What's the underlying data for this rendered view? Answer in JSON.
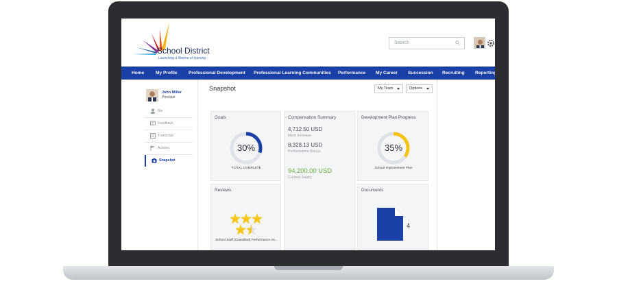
{
  "brand": {
    "name": "School District",
    "tagline": "Launching a lifetime of learning"
  },
  "search": {
    "placeholder": "Search"
  },
  "nav": {
    "items": [
      {
        "label": "Home"
      },
      {
        "label": "My Profile"
      },
      {
        "label": "Professional Development"
      },
      {
        "label": "Professional Learning Communities"
      },
      {
        "label": "Performance"
      },
      {
        "label": "My Career"
      },
      {
        "label": "Succession"
      },
      {
        "label": "Recruiting"
      },
      {
        "label": "Reporting"
      }
    ]
  },
  "profile": {
    "name": "John Miller",
    "role": "Principal"
  },
  "sidebar": {
    "items": [
      {
        "label": "Bio",
        "icon": "user-icon"
      },
      {
        "label": "Feedback",
        "icon": "feedback-icon"
      },
      {
        "label": "Transcript",
        "icon": "transcript-icon"
      },
      {
        "label": "Actions",
        "icon": "flag-icon"
      },
      {
        "label": "Snapshot",
        "icon": "camera-icon",
        "active": true
      }
    ]
  },
  "main": {
    "title": "Snapshot",
    "my_team": "My Team",
    "options": "Options"
  },
  "cards": {
    "goals": {
      "title": "Goals",
      "percent_label": "30%",
      "percent": 30,
      "caption": "TOTAL COMPLETE",
      "color": "#1a3fa6"
    },
    "compensation": {
      "title": "Compensation Summary",
      "merit_value": "4,712.50 USD",
      "merit_label": "Merit Increase",
      "bonus_value": "8,328.13 USD",
      "bonus_label": "Performance Bonus",
      "salary_value": "94,200.00 USD",
      "salary_label": "Current Salary"
    },
    "development": {
      "title": "Development Plan Progress",
      "percent_label": "35%",
      "percent": 35,
      "caption": "School Improvement Plan",
      "color": "#f5c518"
    },
    "reviews": {
      "title": "Reviews",
      "rating": 2.5,
      "max": 3,
      "caption": "School Staff (Classified) Performance As..."
    },
    "documents": {
      "title": "Documents",
      "count": "4"
    }
  },
  "colors": {
    "nav": "#1a3fa6",
    "accent_green": "#6aae3a",
    "star": "#f5c518",
    "doc": "#1a3fa6"
  }
}
